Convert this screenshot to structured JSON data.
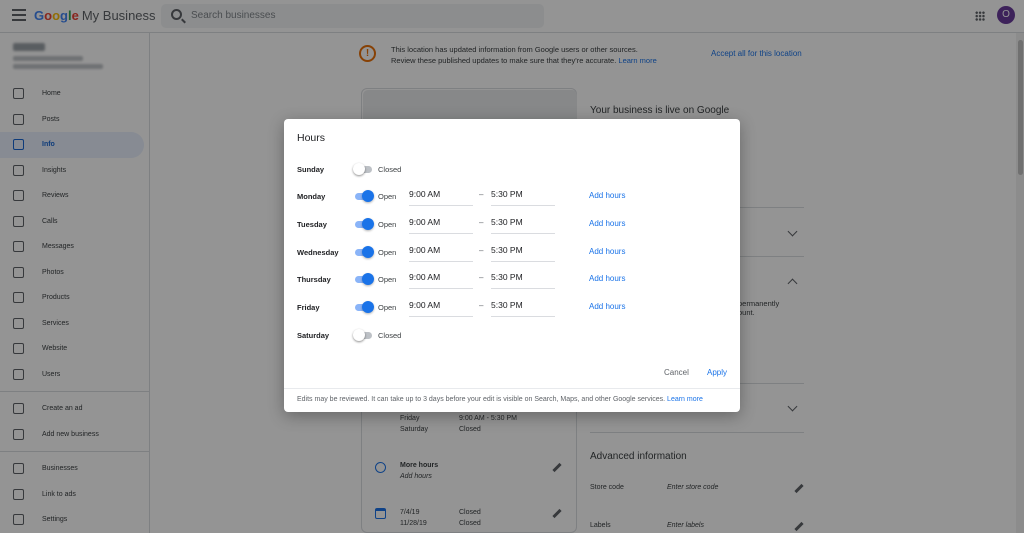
{
  "app": {
    "brand_letters": [
      {
        "ch": "G",
        "cls": "c1"
      },
      {
        "ch": "o",
        "cls": "c2"
      },
      {
        "ch": "o",
        "cls": "c3"
      },
      {
        "ch": "g",
        "cls": "c1"
      },
      {
        "ch": "l",
        "cls": "c4"
      },
      {
        "ch": "e",
        "cls": "c2"
      }
    ],
    "product": "My Business",
    "search_placeholder": "Search businesses",
    "avatar_letter": "O"
  },
  "sidebar": {
    "items": [
      {
        "label": "Home",
        "icon": "home-icon"
      },
      {
        "label": "Posts",
        "icon": "posts-icon"
      },
      {
        "label": "Info",
        "icon": "storefront-icon",
        "active": true
      },
      {
        "label": "Insights",
        "icon": "bar-chart-icon"
      },
      {
        "label": "Reviews",
        "icon": "reviews-icon"
      },
      {
        "label": "Calls",
        "icon": "phone-icon"
      },
      {
        "label": "Messages",
        "icon": "message-icon"
      },
      {
        "label": "Photos",
        "icon": "photos-icon"
      },
      {
        "label": "Products",
        "icon": "basket-icon"
      },
      {
        "label": "Services",
        "icon": "list-icon"
      },
      {
        "label": "Website",
        "icon": "website-icon"
      },
      {
        "label": "Users",
        "icon": "add-user-icon"
      }
    ],
    "items2": [
      {
        "label": "Create an ad",
        "icon": "ads-icon"
      },
      {
        "label": "Add new business",
        "icon": "location-pin-icon"
      }
    ],
    "items3": [
      {
        "label": "Businesses",
        "icon": "storefront-icon"
      },
      {
        "label": "Link to ads",
        "icon": "link-icon"
      },
      {
        "label": "Settings",
        "icon": "gear-icon"
      }
    ]
  },
  "main": {
    "banner_line1": "This location has updated information from Google users or other sources.",
    "banner_line2": "Review these published updates to make sure that they're accurate.",
    "banner_learn_more": "Learn more",
    "accept_all": "Accept all for this location",
    "live_title": "Your business is live on Google",
    "perm_line1": "permanently",
    "perm_line2": "ount.",
    "hours_rows": [
      {
        "day": "Friday",
        "hours": "9:00 AM - 5:30 PM"
      },
      {
        "day": "Saturday",
        "hours": "Closed"
      }
    ],
    "more_hours_title": "More hours",
    "more_hours_sub": "Add hours",
    "special_rows": [
      {
        "date": "7/4/19",
        "status": "Closed"
      },
      {
        "date": "11/28/19",
        "status": "Closed"
      }
    ],
    "advanced_title": "Advanced information",
    "store_code_label": "Store code",
    "store_code_value": "Enter store code",
    "labels_label": "Labels",
    "labels_value": "Enter labels"
  },
  "dialog": {
    "title": "Hours",
    "days": [
      {
        "day": "Sunday",
        "open": false,
        "state": "Closed"
      },
      {
        "day": "Monday",
        "open": true,
        "state": "Open",
        "from": "9:00 AM",
        "to": "5:30 PM"
      },
      {
        "day": "Tuesday",
        "open": true,
        "state": "Open",
        "from": "9:00 AM",
        "to": "5:30 PM"
      },
      {
        "day": "Wednesday",
        "open": true,
        "state": "Open",
        "from": "9:00 AM",
        "to": "5:30 PM"
      },
      {
        "day": "Thursday",
        "open": true,
        "state": "Open",
        "from": "9:00 AM",
        "to": "5:30 PM"
      },
      {
        "day": "Friday",
        "open": true,
        "state": "Open",
        "from": "9:00 AM",
        "to": "5:30 PM"
      },
      {
        "day": "Saturday",
        "open": false,
        "state": "Closed"
      }
    ],
    "separator": "–",
    "add_hours_label": "Add hours",
    "cancel_label": "Cancel",
    "apply_label": "Apply",
    "footer_text": "Edits may be reviewed. It can take up to 3 days before your edit is visible on Search, Maps, and other Google services.",
    "footer_link": "Learn more"
  },
  "colors": {
    "accent": "#1a73e8",
    "warning": "#e8710a",
    "avatar_bg": "#6a3c9c"
  }
}
